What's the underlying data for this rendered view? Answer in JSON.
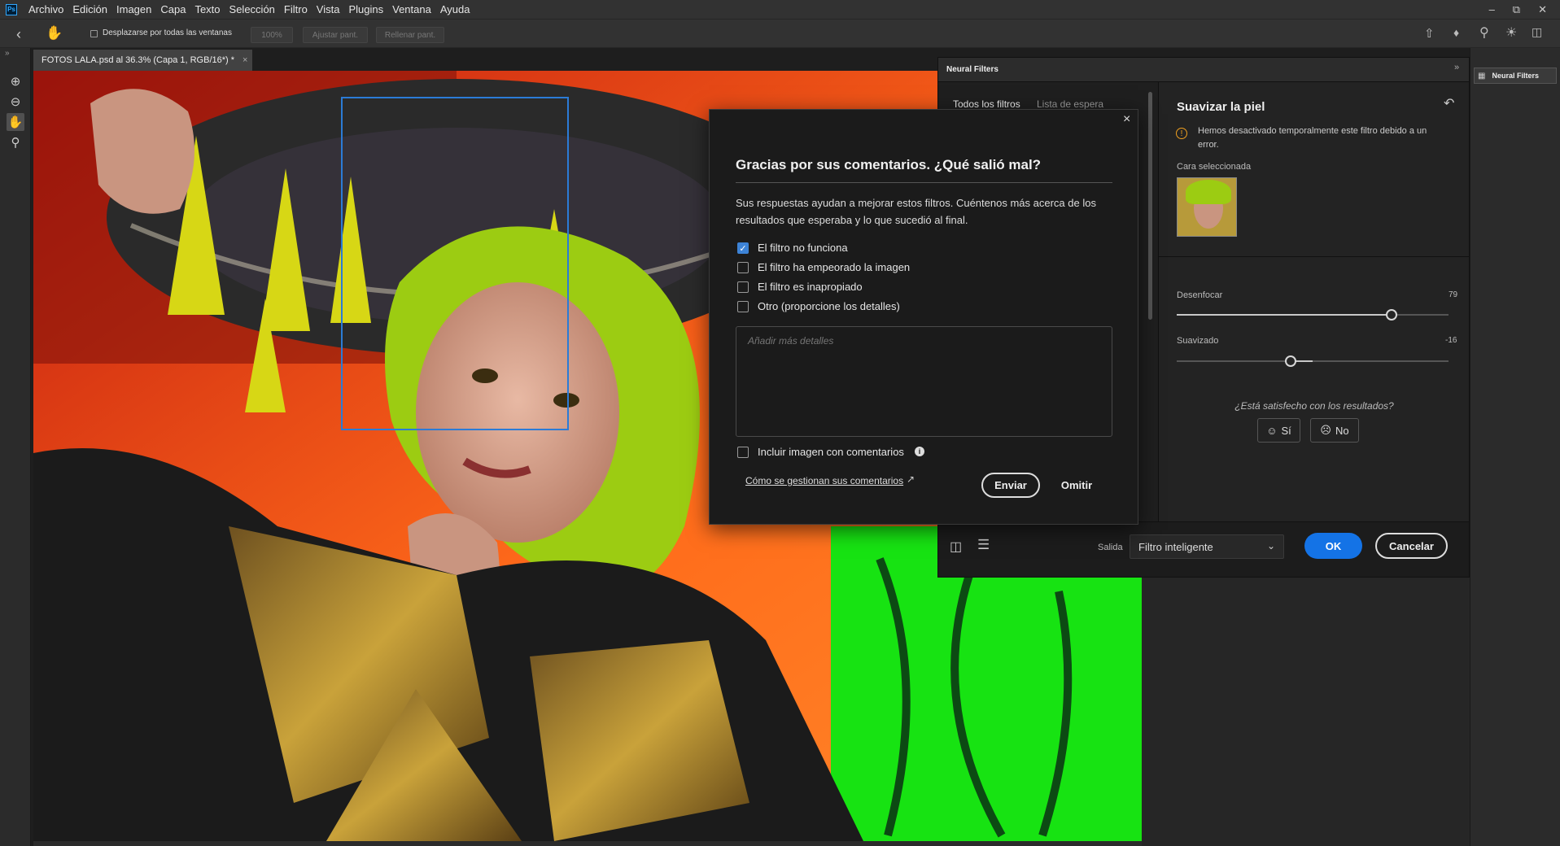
{
  "menu": [
    "Archivo",
    "Edición",
    "Imagen",
    "Capa",
    "Texto",
    "Selección",
    "Filtro",
    "Vista",
    "Plugins",
    "Ventana",
    "Ayuda"
  ],
  "options": {
    "scroll_all_label": "Desplazarse por todas las ventanas",
    "zoom_button": "100%",
    "fit_button": "Ajustar pant.",
    "fill_button": "Rellenar pant."
  },
  "document_tab": "FOTOS LALA.psd al 36.3% (Capa 1, RGB/16*) *",
  "right_dock": {
    "neural_filters_label": "Neural Filters"
  },
  "neural_filters": {
    "panel_title": "Neural Filters",
    "tab_all": "Todos los filtros",
    "tab_waitlist": "Lista de espera",
    "filter_name": "Suavizar la piel",
    "warning": "Hemos desactivado temporalmente este filtro debido a un error.",
    "face_label": "Cara seleccionada",
    "blur_label": "Desenfocar",
    "blur_value": "79",
    "blur_level": 0.79,
    "smooth_label": "Suavizado",
    "smooth_value": "-16",
    "smooth_level": -0.16,
    "satisfied_question": "¿Está satisfecho con los resultados?",
    "yes_label": "Sí",
    "no_label": "No",
    "output_label": "Salida",
    "output_value": "Filtro inteligente",
    "ok_label": "OK",
    "cancel_label": "Cancelar"
  },
  "dialog": {
    "title": "Gracias por sus comentarios. ¿Qué salió mal?",
    "description": "Sus respuestas ayudan a mejorar estos filtros. Cuéntenos más acerca de los resultados que esperaba y lo que sucedió al final.",
    "options": [
      {
        "label": "El filtro no funciona",
        "checked": true
      },
      {
        "label": "El filtro ha empeorado la imagen",
        "checked": false
      },
      {
        "label": "El filtro es inapropiado",
        "checked": false
      },
      {
        "label": "Otro (proporcione los detalles)",
        "checked": false
      }
    ],
    "details_placeholder": "Añadir más detalles",
    "include_image_label": "Incluir imagen con comentarios",
    "privacy_link": "Cómo se gestionan sus comentarios",
    "send_label": "Enviar",
    "skip_label": "Omitir"
  }
}
